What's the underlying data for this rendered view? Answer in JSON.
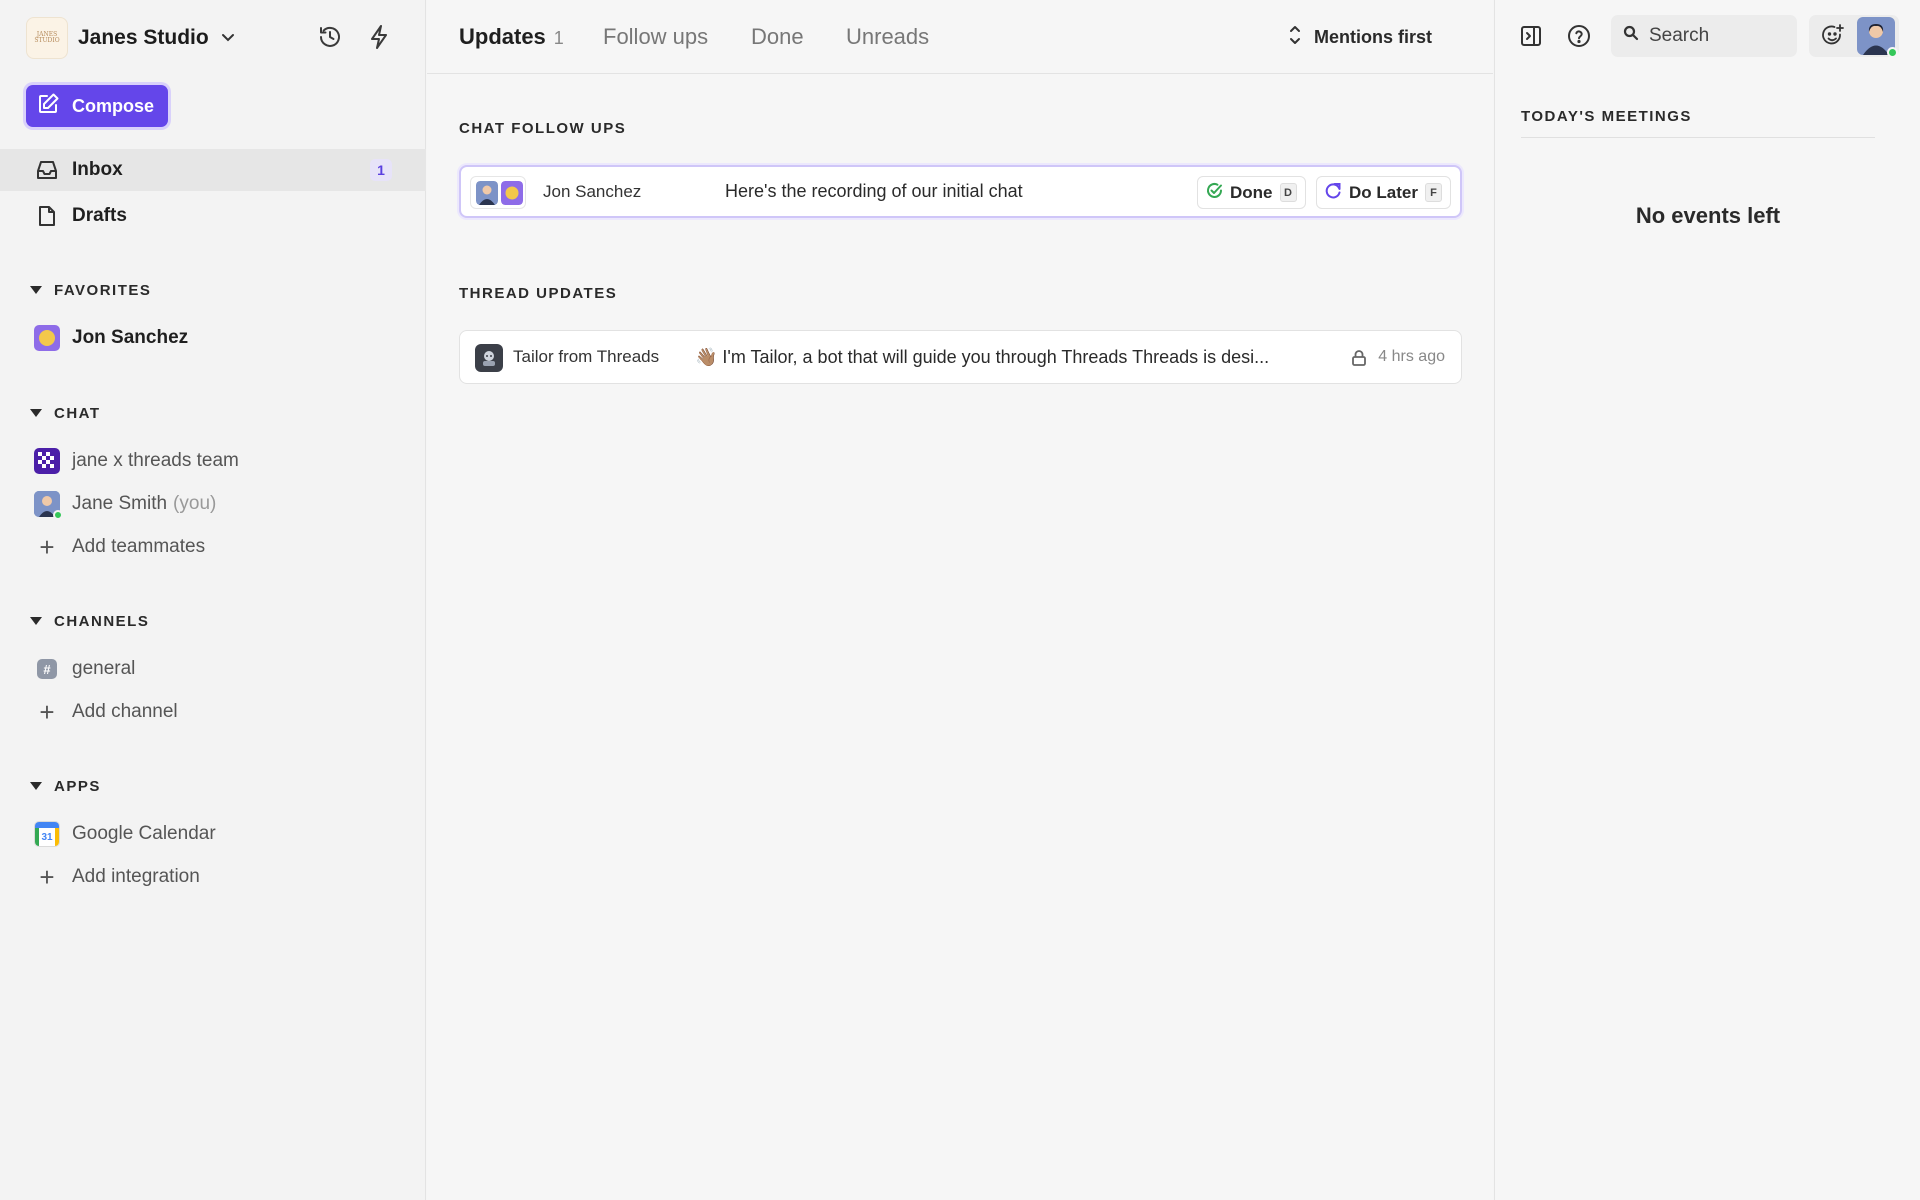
{
  "workspace": {
    "name": "Janes Studio",
    "logo_text": "JANES STUDIO"
  },
  "sidebar": {
    "compose_label": "Compose",
    "nav": [
      {
        "label": "Inbox",
        "badge": "1",
        "icon": "inbox-icon"
      },
      {
        "label": "Drafts",
        "icon": "document-icon"
      }
    ],
    "favorites": {
      "title": "FAVORITES",
      "items": [
        {
          "label": "Jon Sanchez"
        }
      ]
    },
    "chat": {
      "title": "CHAT",
      "items": [
        {
          "label": "jane x threads team"
        },
        {
          "label": "Jane Smith",
          "suffix": "(you)"
        }
      ],
      "add_label": "Add teammates"
    },
    "channels": {
      "title": "CHANNELS",
      "items": [
        {
          "label": "general"
        }
      ],
      "add_label": "Add channel"
    },
    "apps": {
      "title": "APPS",
      "items": [
        {
          "label": "Google Calendar",
          "icon_text": "31"
        }
      ],
      "add_label": "Add integration"
    }
  },
  "main": {
    "tabs": [
      {
        "label": "Updates",
        "count": "1"
      },
      {
        "label": "Follow ups"
      },
      {
        "label": "Done"
      },
      {
        "label": "Unreads"
      }
    ],
    "sort_label": "Mentions first",
    "chat_follow_ups": {
      "title": "CHAT FOLLOW UPS",
      "item": {
        "name": "Jon Sanchez",
        "message": "Here's the recording of our initial chat",
        "done_label": "Done",
        "done_key": "D",
        "later_label": "Do Later",
        "later_key": "F"
      }
    },
    "thread_updates": {
      "title": "THREAD UPDATES",
      "item": {
        "author": "Tailor from Threads",
        "message": "👋🏽 I'm Tailor, a bot that will guide you through Threads Threads is desi...",
        "time": "4 hrs ago"
      }
    }
  },
  "right": {
    "search_placeholder": "Search",
    "meetings_title": "TODAY'S MEETINGS",
    "empty_label": "No events left"
  },
  "colors": {
    "accent": "#6446ea",
    "online": "#34c759"
  }
}
